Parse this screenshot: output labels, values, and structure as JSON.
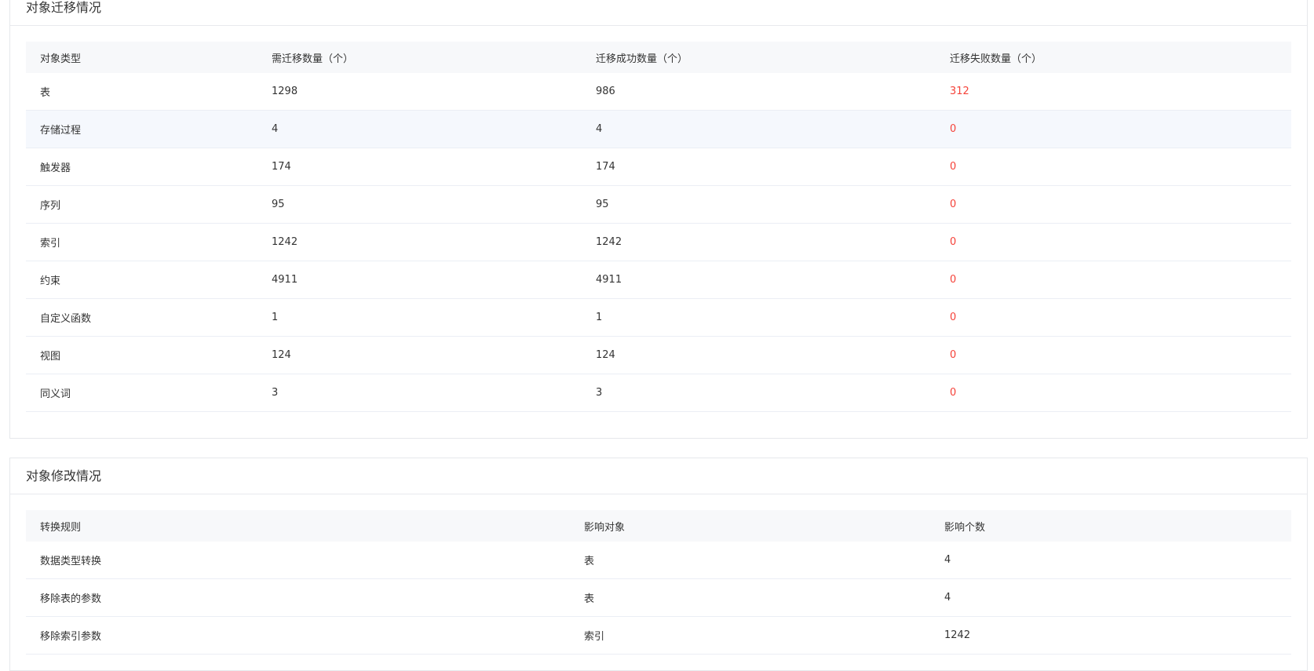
{
  "migration": {
    "title": "对象迁移情况",
    "columns": [
      "对象类型",
      "需迁移数量（个）",
      "迁移成功数量（个）",
      "迁移失败数量（个）"
    ],
    "rows": [
      [
        "表",
        "1298",
        "986",
        "312"
      ],
      [
        "存储过程",
        "4",
        "4",
        "0"
      ],
      [
        "触发器",
        "174",
        "174",
        "0"
      ],
      [
        "序列",
        "95",
        "95",
        "0"
      ],
      [
        "索引",
        "1242",
        "1242",
        "0"
      ],
      [
        "约束",
        "4911",
        "4911",
        "0"
      ],
      [
        "自定义函数",
        "1",
        "1",
        "0"
      ],
      [
        "视图",
        "124",
        "124",
        "0"
      ],
      [
        "同义词",
        "3",
        "3",
        "0"
      ]
    ]
  },
  "modification": {
    "title": "对象修改情况",
    "columns": [
      "转换规则",
      "影响对象",
      "影响个数"
    ],
    "rows": [
      [
        "数据类型转换",
        "表",
        "4"
      ],
      [
        "移除表的参数",
        "表",
        "4"
      ],
      [
        "移除索引参数",
        "索引",
        "1242"
      ]
    ]
  },
  "colors": {
    "fail_text": "#f5433a",
    "header_bg": "#f7f8fa",
    "hover_row_bg": "#f5f8fd",
    "border": "#e6e8eb"
  }
}
